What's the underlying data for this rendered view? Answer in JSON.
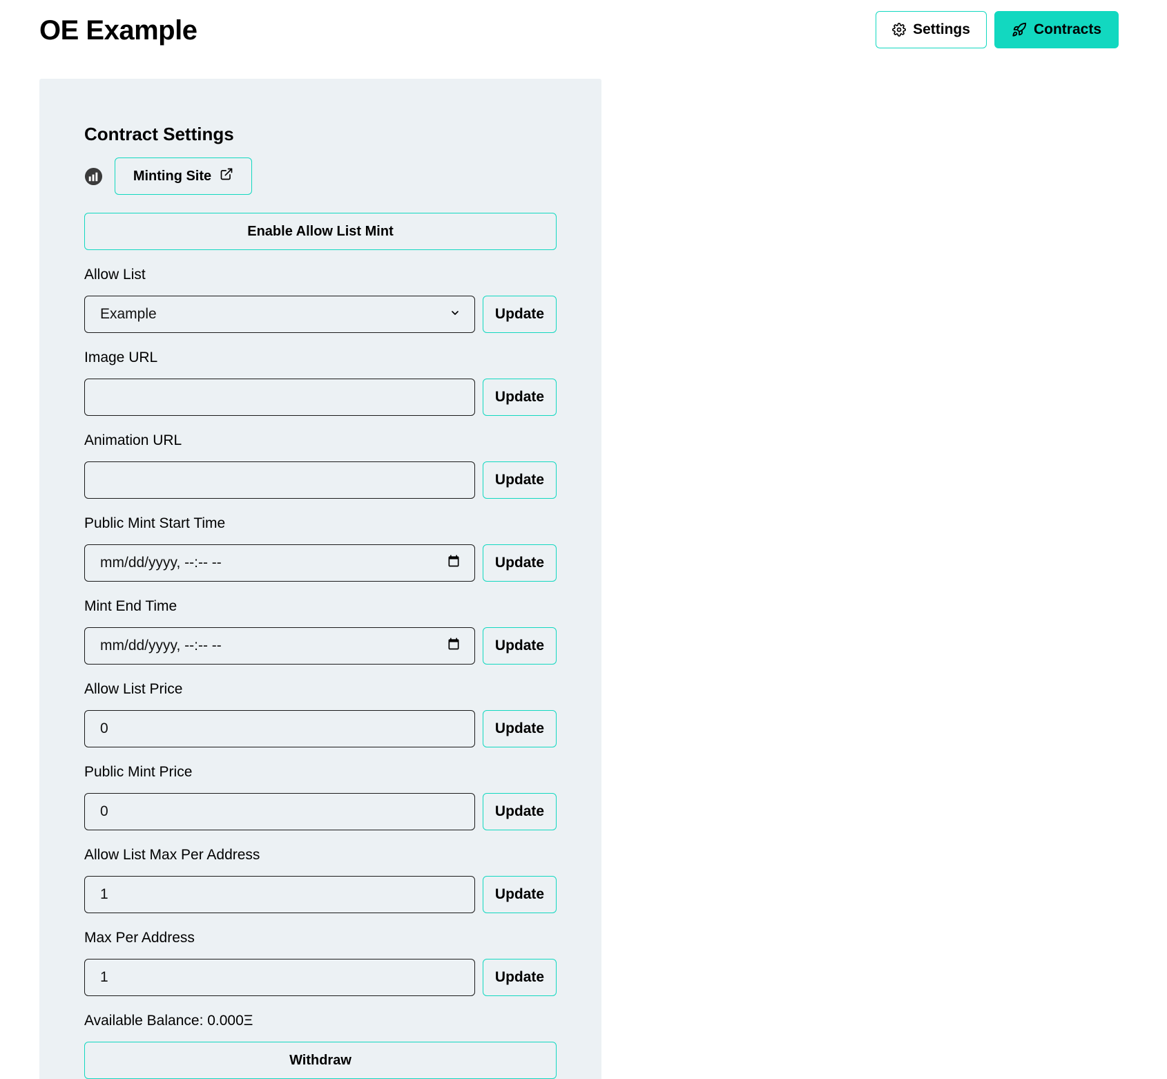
{
  "header": {
    "title": "OE Example",
    "settings_label": "Settings",
    "contracts_label": "Contracts",
    "settings_icon": "gear-icon",
    "contracts_icon": "rocket-icon"
  },
  "panel": {
    "title": "Contract Settings",
    "minting_site_label": "Minting Site",
    "minting_site_icon": "external-link-icon",
    "enable_allow_list_label": "Enable Allow List Mint",
    "update_label": "Update",
    "fields": {
      "allow_list": {
        "label": "Allow List",
        "value": "Example"
      },
      "image_url": {
        "label": "Image URL",
        "value": ""
      },
      "animation_url": {
        "label": "Animation URL",
        "value": ""
      },
      "public_mint_start": {
        "label": "Public Mint Start Time",
        "value": "mm/dd/yyyy, --:-- --"
      },
      "mint_end": {
        "label": "Mint End Time",
        "value": "mm/dd/yyyy, --:-- --"
      },
      "allow_list_price": {
        "label": "Allow List Price",
        "value": "0"
      },
      "public_mint_price": {
        "label": "Public Mint Price",
        "value": "0"
      },
      "allow_list_max": {
        "label": "Allow List Max Per Address",
        "value": "1"
      },
      "max_per_address": {
        "label": "Max Per Address",
        "value": "1"
      }
    },
    "balance_text": "Available Balance: 0.000Ξ",
    "withdraw_label": "Withdraw"
  },
  "colors": {
    "accent": "#12d8c0",
    "panel_bg": "#ecf1f4",
    "text": "#000000",
    "border": "#1a1a1a"
  }
}
